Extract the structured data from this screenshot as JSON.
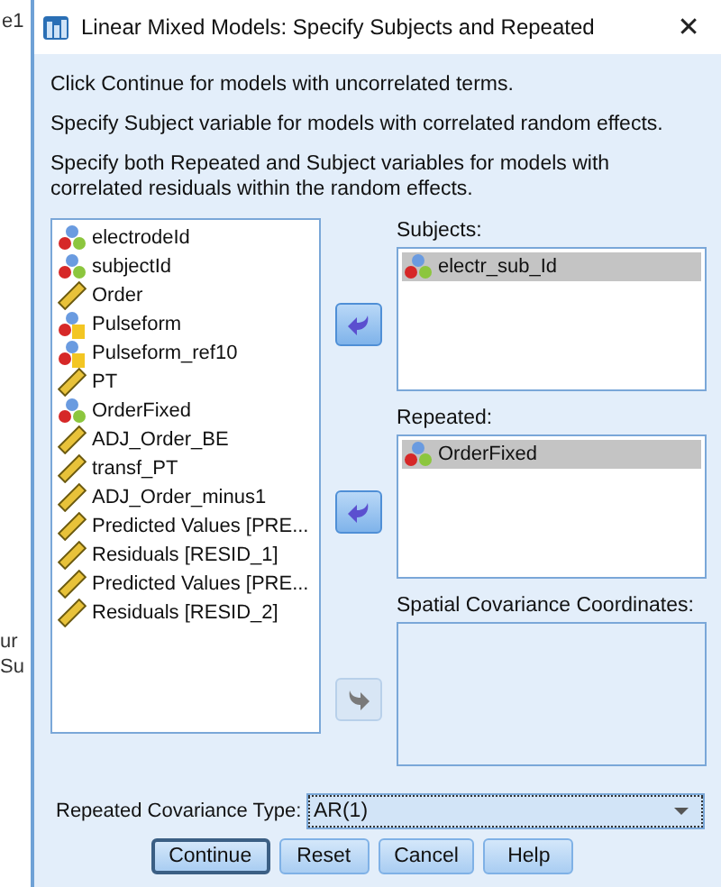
{
  "background_window": {
    "fragments": [
      "e1",
      "ur",
      "Su"
    ]
  },
  "window": {
    "title": "Linear Mixed Models: Specify Subjects and Repeated",
    "close": "✕"
  },
  "instructions": [
    "Click Continue for models with uncorrelated terms.",
    "Specify Subject variable for models with correlated random effects.",
    "Specify both Repeated and Subject variables for models with correlated residuals within the random effects."
  ],
  "variables": [
    {
      "name": "electrodeId",
      "kind": "nominal"
    },
    {
      "name": "subjectId",
      "kind": "nominal"
    },
    {
      "name": "Order",
      "kind": "scale"
    },
    {
      "name": "Pulseform",
      "kind": "nominal_string"
    },
    {
      "name": "Pulseform_ref10",
      "kind": "nominal_string"
    },
    {
      "name": "PT",
      "kind": "scale"
    },
    {
      "name": "OrderFixed",
      "kind": "nominal"
    },
    {
      "name": "ADJ_Order_BE",
      "kind": "scale"
    },
    {
      "name": "transf_PT",
      "kind": "scale"
    },
    {
      "name": "ADJ_Order_minus1",
      "kind": "scale"
    },
    {
      "name": "Predicted Values [PRE...",
      "kind": "scale"
    },
    {
      "name": "Residuals [RESID_1]",
      "kind": "scale"
    },
    {
      "name": "Predicted Values [PRE...",
      "kind": "scale"
    },
    {
      "name": "Residuals [RESID_2]",
      "kind": "scale"
    }
  ],
  "targets": [
    {
      "label": "Subjects:",
      "arrow": {
        "kind": "move_left",
        "disabled": false
      },
      "items": [
        {
          "name": "electr_sub_Id",
          "kind": "nominal",
          "selected": true
        }
      ]
    },
    {
      "label": "Repeated:",
      "arrow": {
        "kind": "move_left",
        "disabled": false
      },
      "items": [
        {
          "name": "OrderFixed",
          "kind": "nominal",
          "selected": true
        }
      ]
    },
    {
      "label": "Spatial Covariance Coordinates:",
      "arrow": {
        "kind": "move_right",
        "disabled": true
      }
    }
  ],
  "covariance_type": {
    "label": "Repeated Covariance Type:",
    "value": "AR(1)"
  },
  "buttons": [
    {
      "label": "Continue",
      "default": true
    },
    {
      "label": "Reset",
      "default": false
    },
    {
      "label": "Cancel",
      "default": false
    },
    {
      "label": "Help",
      "default": false
    }
  ]
}
